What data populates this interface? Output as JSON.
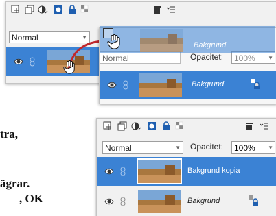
{
  "panel1": {
    "blend_mode": "Normal"
  },
  "panel2": {
    "blend_mode": "Normal",
    "opacity_label": "Opacitet:",
    "opacity_value": "100%",
    "drag_ghost_label": "Bakgrund",
    "layer_name": "Bakgrund"
  },
  "panel3": {
    "blend_mode": "Normal",
    "opacity_label": "Opacitet:",
    "opacity_value": "100%",
    "layers": [
      {
        "name": "Bakgrund kopia"
      },
      {
        "name": "Bakgrund"
      }
    ]
  },
  "body_text": {
    "line1": "tra,",
    "line2": "ägrar.",
    "line3": ", OK"
  },
  "colors": {
    "selected": "#3b82d4",
    "panel_bg": "#f1f1f1",
    "arrow": "#c0282d"
  },
  "icons": [
    "new-layer-icon",
    "duplicate-layer-icon",
    "adjustment-icon",
    "mask-icon",
    "lock-icon",
    "lock-transparency-icon",
    "trash-icon",
    "panel-menu-icon",
    "eye-icon",
    "link-icon",
    "hand-cursor-icon"
  ]
}
